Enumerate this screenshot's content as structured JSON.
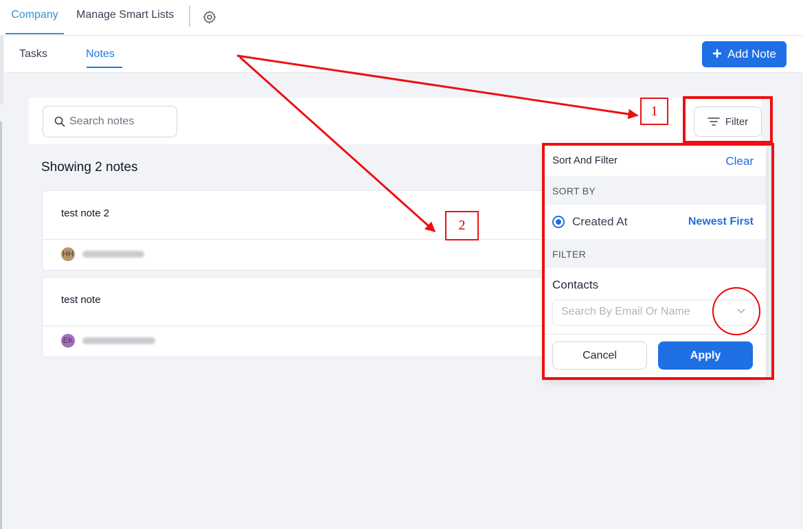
{
  "topbar": {
    "tabs": [
      {
        "label": "Company",
        "active": true
      },
      {
        "label": "Manage Smart Lists",
        "active": false
      }
    ],
    "settings_icon": "gear-icon"
  },
  "subbar": {
    "tabs": [
      {
        "label": "Tasks",
        "active": false
      },
      {
        "label": "Notes",
        "active": true
      }
    ],
    "add_button": {
      "label": "Add Note",
      "icon": "plus-icon"
    }
  },
  "search": {
    "placeholder": "Search notes",
    "value": "",
    "icon": "search-icon"
  },
  "filter_button": {
    "label": "Filter",
    "icon": "filter-lines-icon"
  },
  "summary": "Showing 2 notes",
  "notes": [
    {
      "title": "test note 2",
      "author_initials": "HH",
      "avatar_color": "#b8956a"
    },
    {
      "title": "test note",
      "author_initials": "EK",
      "avatar_color": "#a86cc1"
    }
  ],
  "dropdown": {
    "header": "Sort And Filter",
    "clear_label": "Clear",
    "sort_section": "SORT BY",
    "sort_option": "Created At",
    "sort_order": "Newest First",
    "filter_section": "FILTER",
    "contacts_label": "Contacts",
    "contacts_placeholder": "Search By Email Or Name",
    "cancel_label": "Cancel",
    "apply_label": "Apply"
  },
  "annotations": {
    "marker_1": "1",
    "marker_2": "2",
    "color": "#ee0f0f"
  },
  "colors": {
    "accent": "#1f6fe5",
    "tab_active": "#2f8fd6",
    "background": "#f1f3f7"
  }
}
